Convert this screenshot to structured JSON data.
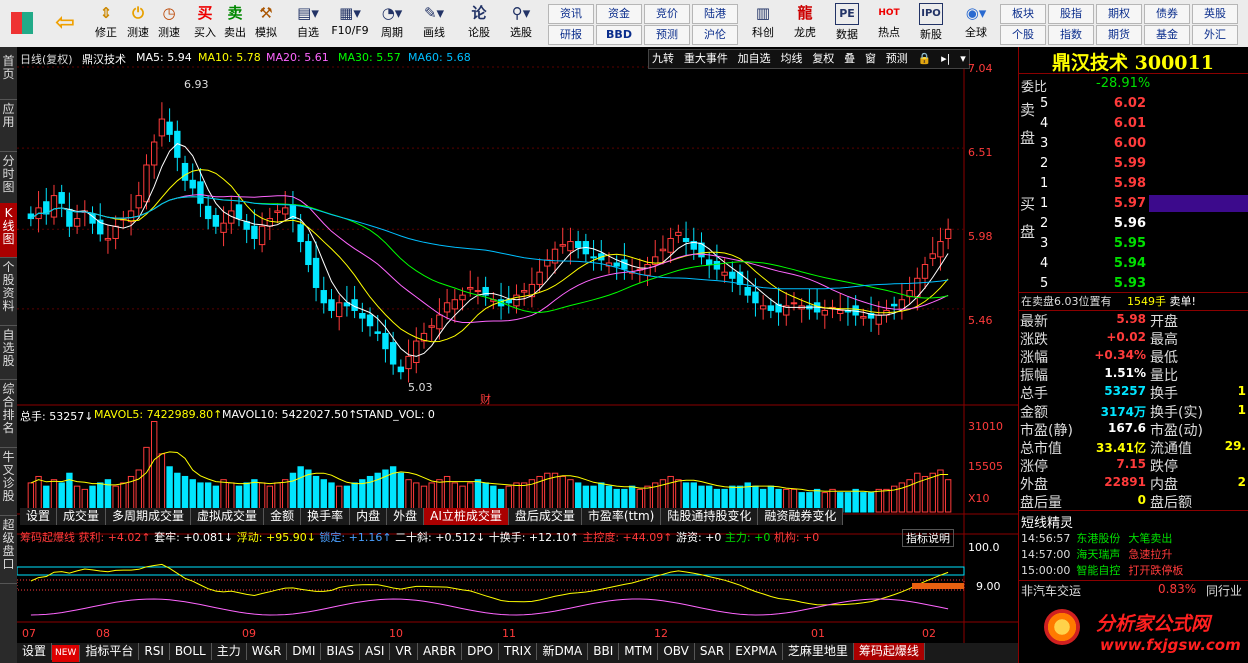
{
  "toolbar": {
    "buttons": [
      {
        "icon": "windows",
        "label": ""
      },
      {
        "icon": "back-arrow",
        "label": ""
      },
      {
        "icon": "modify",
        "label": "修正"
      },
      {
        "icon": "speed",
        "label": "测速"
      },
      {
        "icon": "buy",
        "label": "买入",
        "glyph": "买"
      },
      {
        "icon": "sell",
        "label": "卖出",
        "glyph": "卖"
      },
      {
        "icon": "hammer",
        "label": "模拟"
      },
      {
        "icon": "favorite",
        "label": "自选"
      },
      {
        "icon": "f10",
        "label": "F10/F9"
      },
      {
        "icon": "period",
        "label": "周期"
      },
      {
        "icon": "draw",
        "label": "画线"
      },
      {
        "icon": "forum",
        "label": "论股"
      },
      {
        "icon": "select",
        "label": "选股"
      }
    ],
    "small_buttons": [
      [
        "资讯",
        "资金",
        "竞价",
        "陆港"
      ],
      [
        "研报",
        "BBD",
        "预测",
        "沪伦"
      ]
    ],
    "buttons2": [
      {
        "icon": "kchuang",
        "label": "科创"
      },
      {
        "icon": "dragon",
        "label": "龙虎"
      },
      {
        "icon": "pe",
        "label": "数据",
        "glyph": "PE"
      },
      {
        "icon": "hot",
        "label": "热点",
        "glyph": "HOT"
      },
      {
        "icon": "ipo",
        "label": "新股"
      },
      {
        "icon": "globe",
        "label": "全球"
      }
    ],
    "small_buttons2": [
      [
        "板块",
        "股指",
        "期权",
        "债券",
        "英股"
      ],
      [
        "个股",
        "指数",
        "期货",
        "基金",
        "外汇"
      ]
    ]
  },
  "left_tabs": [
    "首页",
    "应用",
    "分时图",
    "K线图",
    "个股资料",
    "自选股",
    "综合排名",
    "牛叉诊股",
    "超级盘口"
  ],
  "chart_header": {
    "title": "日线(复权)",
    "stock": "鼎汉技术",
    "ma": [
      {
        "label": "MA5: 5.94",
        "color": "#ffffff"
      },
      {
        "label": "MA10: 5.78",
        "color": "#ffff00"
      },
      {
        "label": "MA20: 5.61",
        "color": "#ff66ff"
      },
      {
        "label": "MA30: 5.57",
        "color": "#00ff00"
      },
      {
        "label": "MA60: 5.68",
        "color": "#00bfff"
      }
    ],
    "buttons": [
      "九转",
      "重大事件",
      "加自选",
      "均线",
      "复权",
      "叠",
      "窗",
      "预测"
    ]
  },
  "price_axis": [
    "7.04",
    "6.51",
    "5.98",
    "5.46"
  ],
  "annotations": {
    "high": "6.93",
    "low": "5.03",
    "cai": "财"
  },
  "volume_header": {
    "total": "总手: 53257↓",
    "mavol5": "MAVOL5: 7422989.80↑",
    "mavol10": "MAVOL10: 5422027.50↑",
    "stand": "STAND_VOL: 0"
  },
  "volume_axis": [
    "31010",
    "15505",
    "X10"
  ],
  "indicator_tabs": [
    "设置",
    "成交量",
    "多周期成交量",
    "虚拟成交量",
    "金额",
    "换手率",
    "内盘",
    "外盘",
    "AI立桩成交量",
    "盘后成交量",
    "市盈率(ttm)",
    "陆股通持股变化",
    "融资融券变化"
  ],
  "indicator_tabs_active": 8,
  "indicator_header": {
    "name": "筹码起爆线",
    "items": [
      "获利: +4.02↑",
      "套牢: +0.081↓",
      "浮动: +95.90↓",
      "锁定: +1.16↑",
      "二十斜: +0.512↓",
      "十换手: +12.10↑",
      "主控度: +44.09↑",
      "游资: +0",
      "主力: +0",
      "机构: +0"
    ],
    "explain": "指标说明"
  },
  "indicator_axis": [
    "100.0",
    "9.00"
  ],
  "months": [
    "07",
    "08",
    "09",
    "10",
    "11",
    "12",
    "01",
    "02"
  ],
  "bottom_tabs": [
    "设置",
    "NEW",
    "指标平台",
    "RSI",
    "BOLL",
    "主力",
    "W&R",
    "DMI",
    "BIAS",
    "ASI",
    "VR",
    "ARBR",
    "DPO",
    "TRIX",
    "新DMA",
    "BBI",
    "MTM",
    "OBV",
    "SAR",
    "EXPMA",
    "芝麻里地里",
    "筹码起爆线"
  ],
  "quote": {
    "name": "鼎汉技术",
    "code": "300011",
    "weibi_label": "委比",
    "weibi": "-28.91%",
    "sell_label": "卖盘",
    "buy_label": "买盘",
    "sell": [
      [
        "5",
        "6.02"
      ],
      [
        "4",
        "6.01"
      ],
      [
        "3",
        "6.00"
      ],
      [
        "2",
        "5.99"
      ],
      [
        "1",
        "5.98"
      ]
    ],
    "buy": [
      [
        "1",
        "5.97"
      ],
      [
        "2",
        "5.96"
      ],
      [
        "3",
        "5.95"
      ],
      [
        "4",
        "5.94"
      ],
      [
        "5",
        "5.93"
      ]
    ],
    "order_note": "在卖盘6.03位置有",
    "order_vol": "1549手",
    "order_tag": "卖单!",
    "stats_left": [
      [
        "最新",
        "5.98"
      ],
      [
        "涨跌",
        "+0.02"
      ],
      [
        "涨幅",
        "+0.34%"
      ],
      [
        "振幅",
        "1.51%"
      ],
      [
        "总手",
        "53257"
      ],
      [
        "金额",
        "3174万"
      ],
      [
        "市盈(静)",
        "167.6"
      ],
      [
        "总市值",
        "33.41亿"
      ],
      [
        "涨停",
        "7.15"
      ],
      [
        "外盘",
        "22891"
      ],
      [
        "盘后量",
        "0"
      ]
    ],
    "stats_right": [
      "开盘",
      "最高",
      "最低",
      "量比",
      "换手",
      "换手(实)",
      "市盈(动)",
      "流通值",
      "跌停",
      "内盘",
      "盘后额"
    ],
    "partial_right": [
      "",
      "",
      "",
      "",
      "1",
      "1",
      "",
      "29.",
      "",
      "2",
      ""
    ]
  },
  "news": {
    "title": "短线精灵",
    "items": [
      [
        "14:56:57",
        "东港股份",
        "大笔卖出"
      ],
      [
        "14:57:00",
        "海天瑞声",
        "急速拉升"
      ],
      [
        "15:00:00",
        "智能自控",
        "打开跌停板"
      ]
    ],
    "sector": "非汽车交运",
    "sector_pct": "0.83%",
    "sector_tag": "同行业"
  },
  "watermark": {
    "title": "分析家公式网",
    "url": "www.fxjgsw.com"
  },
  "chart_data": {
    "type": "candlestick",
    "title": "鼎汉技术 日线(复权)",
    "ylim": [
      4.95,
      7.04
    ],
    "x_labels": [
      "07",
      "08",
      "09",
      "10",
      "11",
      "12",
      "01",
      "02"
    ],
    "high_mark": 6.93,
    "low_mark": 5.03,
    "close": [
      6.05,
      6.12,
      6.08,
      6.2,
      6.15,
      6.0,
      6.05,
      6.1,
      6.02,
      5.95,
      5.92,
      6.0,
      6.05,
      6.1,
      6.2,
      6.4,
      6.55,
      6.7,
      6.6,
      6.45,
      6.3,
      6.25,
      6.15,
      6.05,
      6.0,
      6.02,
      6.1,
      6.05,
      5.98,
      5.92,
      6.0,
      6.05,
      6.1,
      6.12,
      6.05,
      5.9,
      5.75,
      5.6,
      5.5,
      5.45,
      5.5,
      5.48,
      5.45,
      5.4,
      5.35,
      5.3,
      5.2,
      5.1,
      5.05,
      5.15,
      5.25,
      5.3,
      5.35,
      5.42,
      5.5,
      5.52,
      5.55,
      5.6,
      5.58,
      5.55,
      5.52,
      5.48,
      5.5,
      5.55,
      5.58,
      5.62,
      5.7,
      5.78,
      5.85,
      5.88,
      5.9,
      5.86,
      5.82,
      5.8,
      5.78,
      5.76,
      5.74,
      5.72,
      5.7,
      5.72,
      5.75,
      5.8,
      5.85,
      5.92,
      5.96,
      5.9,
      5.85,
      5.8,
      5.75,
      5.72,
      5.7,
      5.66,
      5.62,
      5.55,
      5.5,
      5.48,
      5.45,
      5.44,
      5.48,
      5.5,
      5.48,
      5.46,
      5.44,
      5.45,
      5.47,
      5.45,
      5.44,
      5.42,
      5.41,
      5.4,
      5.42,
      5.45,
      5.48,
      5.52,
      5.58,
      5.66,
      5.75,
      5.82,
      5.9,
      5.98
    ],
    "volume": [
      9,
      11,
      8,
      10,
      9,
      12,
      8,
      7,
      8,
      9,
      10,
      8,
      9,
      11,
      13,
      20,
      28,
      18,
      14,
      12,
      11,
      10,
      9,
      9,
      8,
      10,
      9,
      8,
      9,
      10,
      9,
      8,
      9,
      10,
      12,
      14,
      13,
      11,
      10,
      9,
      8,
      8,
      9,
      10,
      11,
      12,
      13,
      14,
      12,
      10,
      9,
      8,
      9,
      10,
      11,
      9,
      8,
      9,
      10,
      9,
      8,
      7,
      8,
      9,
      9,
      10,
      11,
      12,
      12,
      11,
      10,
      9,
      8,
      8,
      9,
      8,
      7,
      7,
      8,
      7,
      8,
      9,
      10,
      11,
      10,
      9,
      9,
      8,
      8,
      7,
      7,
      8,
      8,
      9,
      8,
      7,
      8,
      7,
      7,
      7,
      6,
      6,
      7,
      6,
      7,
      6,
      6,
      7,
      6,
      6,
      7,
      7,
      8,
      9,
      10,
      12,
      11,
      12,
      13,
      10
    ],
    "ma_series": [
      {
        "name": "MA5",
        "color": "#ffffff"
      },
      {
        "name": "MA10",
        "color": "#ffff00"
      },
      {
        "name": "MA20",
        "color": "#ff66ff"
      },
      {
        "name": "MA30",
        "color": "#00ff00"
      },
      {
        "name": "MA60",
        "color": "#00bfff"
      }
    ],
    "volume_ylim": [
      0,
      31010
    ]
  }
}
